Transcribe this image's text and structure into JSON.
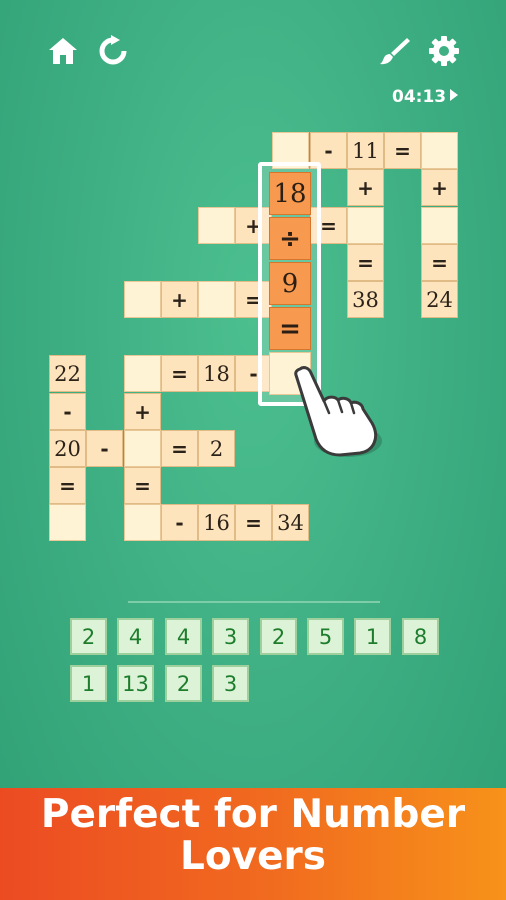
{
  "toolbar": {
    "left": [
      {
        "icon": "home-icon"
      },
      {
        "icon": "restart-icon"
      }
    ],
    "right": [
      {
        "icon": "paintbrush-icon"
      },
      {
        "icon": "gear-icon"
      }
    ],
    "icon_color": "#ffffff"
  },
  "timer": {
    "text": "04:13"
  },
  "board": {
    "rows": [
      [
        "",
        "",
        "",
        "",
        "",
        "",
        "",
        "",
        "",
        "",
        "",
        ""
      ],
      [
        "",
        "",
        "",
        "",
        "",
        "",
        "",
        "_",
        "-",
        "11",
        "=",
        "_"
      ],
      [
        "",
        "",
        "",
        "",
        "",
        "",
        "",
        "",
        "",
        "+",
        "",
        "+"
      ],
      [
        "",
        "",
        "",
        "",
        "",
        "_",
        "+",
        "",
        "=",
        "_",
        "",
        "_"
      ],
      [
        "",
        "",
        "",
        "",
        "",
        "",
        "",
        "",
        "",
        "=",
        "",
        "="
      ],
      [
        "",
        "",
        "",
        "_",
        "+",
        "_",
        "=",
        "",
        "",
        "38",
        "",
        "24"
      ],
      [
        "",
        "",
        "",
        "",
        "",
        "",
        "",
        "",
        "",
        "",
        "",
        ""
      ],
      [
        "",
        "22",
        "",
        "_",
        "=",
        "18",
        "-",
        "",
        "",
        "",
        "",
        ""
      ],
      [
        "",
        "-",
        "",
        "+",
        "",
        "",
        "",
        "",
        "",
        "",
        "",
        ""
      ],
      [
        "",
        "20",
        "-",
        "_",
        "=",
        "2",
        "",
        "",
        "",
        "",
        "",
        ""
      ],
      [
        "",
        "=",
        "",
        "=",
        "",
        "",
        "",
        "",
        "",
        "",
        "",
        ""
      ],
      [
        "",
        "_",
        "",
        "_",
        "-",
        "16",
        "=",
        "34",
        "",
        "",
        "",
        ""
      ]
    ]
  },
  "drag_piece": {
    "cells": [
      "18",
      "÷",
      "9",
      "=",
      ""
    ],
    "highlight_color": "#f79a4f"
  },
  "tray": {
    "rows": [
      [
        "2",
        "4",
        "4",
        "3",
        "2",
        "5",
        "1",
        "8"
      ],
      [
        "1",
        "13",
        "2",
        "3"
      ]
    ],
    "tile_bg": "#dcf3d8",
    "tile_text": "#1e7d2c"
  },
  "banner": {
    "text": "Perfect for Number\nLovers",
    "gradient": [
      "#ec4b22",
      "#f7921a"
    ]
  }
}
